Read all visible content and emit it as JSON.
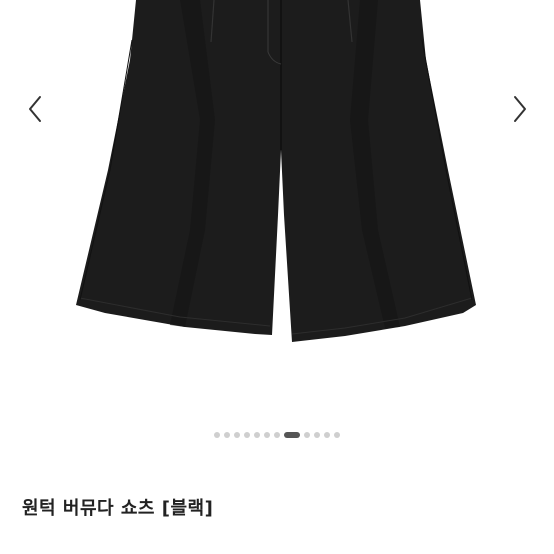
{
  "product": {
    "title": "원턱 버뮤다 쇼츠 [블랙]",
    "image": "black-bermuda-shorts"
  },
  "gallery": {
    "prev_icon": "chevron-left-icon",
    "next_icon": "chevron-right-icon",
    "slide_count": 12,
    "active_slide": 8
  },
  "colors": {
    "garment": "#1c1c1c",
    "dot_inactive": "#cfcfcf",
    "dot_active": "#555555",
    "arrow": "#333333"
  }
}
